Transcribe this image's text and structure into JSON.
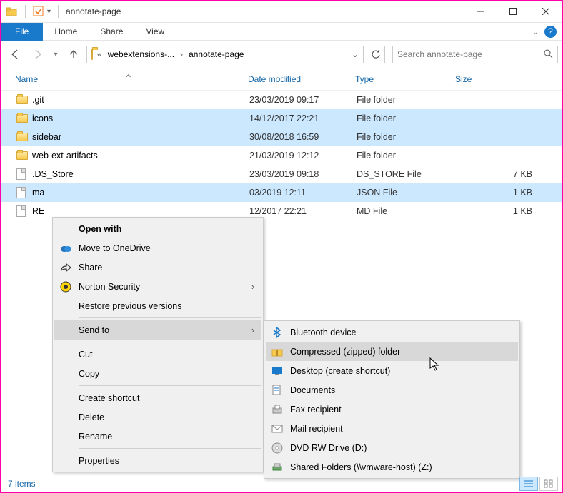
{
  "titlebar": {
    "title": "annotate-page"
  },
  "ribbon": {
    "file": "File",
    "tabs": [
      "Home",
      "Share",
      "View"
    ]
  },
  "breadcrumb": {
    "prefix": "«",
    "part1": "webextensions-...",
    "part2": "annotate-page"
  },
  "search": {
    "placeholder": "Search annotate-page"
  },
  "columns": {
    "name": "Name",
    "date": "Date modified",
    "type": "Type",
    "size": "Size"
  },
  "files": [
    {
      "name": ".git",
      "date": "23/03/2019 09:17",
      "type": "File folder",
      "size": "",
      "icon": "folder",
      "sel": false
    },
    {
      "name": "icons",
      "date": "14/12/2017 22:21",
      "type": "File folder",
      "size": "",
      "icon": "folder",
      "sel": true
    },
    {
      "name": "sidebar",
      "date": "30/08/2018 16:59",
      "type": "File folder",
      "size": "",
      "icon": "folder",
      "sel": true
    },
    {
      "name": "web-ext-artifacts",
      "date": "21/03/2019 12:12",
      "type": "File folder",
      "size": "",
      "icon": "folder",
      "sel": false
    },
    {
      "name": ".DS_Store",
      "date": "23/03/2019 09:18",
      "type": "DS_STORE File",
      "size": "7 KB",
      "icon": "file",
      "sel": false
    },
    {
      "name": "ma",
      "date": "03/2019 12:11",
      "type": "JSON File",
      "size": "1 KB",
      "icon": "file",
      "sel": true
    },
    {
      "name": "RE",
      "date": "12/2017 22:21",
      "type": "MD File",
      "size": "1 KB",
      "icon": "file",
      "sel": false
    }
  ],
  "ctx": {
    "open_with": "Open with",
    "onedrive": "Move to OneDrive",
    "share": "Share",
    "norton": "Norton Security",
    "restore": "Restore previous versions",
    "sendto": "Send to",
    "cut": "Cut",
    "copy": "Copy",
    "shortcut": "Create shortcut",
    "delete": "Delete",
    "rename": "Rename",
    "properties": "Properties"
  },
  "sendto": {
    "bluetooth": "Bluetooth device",
    "zip": "Compressed (zipped) folder",
    "desktop": "Desktop (create shortcut)",
    "documents": "Documents",
    "fax": "Fax recipient",
    "mail": "Mail recipient",
    "dvd": "DVD RW Drive (D:)",
    "shared": "Shared Folders (\\\\vmware-host) (Z:)"
  },
  "status": {
    "count": "7 items"
  }
}
